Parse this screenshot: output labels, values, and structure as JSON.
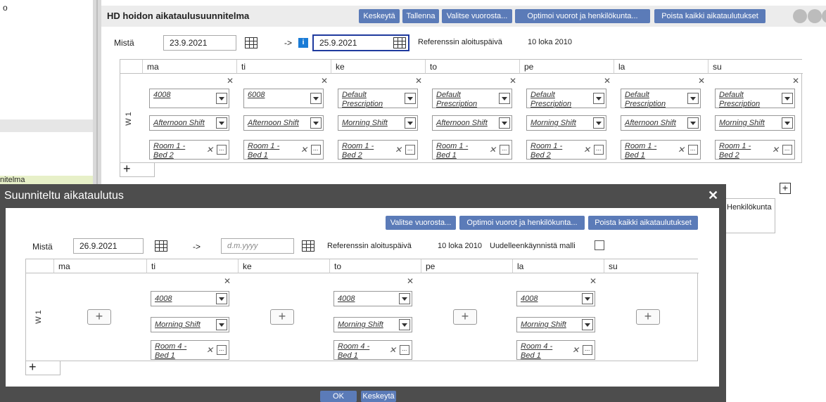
{
  "sidebar": {
    "top_text": "o",
    "green_label": "nitelma"
  },
  "main": {
    "title": "HD hoidon aikataulusuunnitelma",
    "buttons": [
      "Keskeytä",
      "Tallenna",
      "Valitse vuorosta...",
      "Optimoi vuorot ja henkilökunta...",
      "Poista kaikki aikataulutukset"
    ],
    "from_label": "Mistä",
    "from_date": "23.9.2021",
    "arrow": "->",
    "to_date": "25.9.2021",
    "ref_label": "Referenssin aloituspäivä",
    "ref_date": "10 loka 2010",
    "days": [
      "ma",
      "ti",
      "ke",
      "to",
      "pe",
      "la",
      "su"
    ],
    "week": "W 1",
    "cells": [
      {
        "presc": "4008",
        "shift": "Afternoon Shift",
        "room": "Room 1 - Bed 2"
      },
      {
        "presc": "6008",
        "shift": "Afternoon Shift",
        "room": "Room 1 - Bed 1"
      },
      {
        "presc": "Default Prescription",
        "shift": "Morning Shift",
        "room": "Room 1 - Bed 2"
      },
      {
        "presc": "Default Prescription",
        "shift": "Afternoon Shift",
        "room": "Room 1 - Bed 1"
      },
      {
        "presc": "Default Prescription",
        "shift": "Morning Shift",
        "room": "Room 1 - Bed 2"
      },
      {
        "presc": "Default Prescription",
        "shift": "Afternoon Shift",
        "room": "Room 1 - Bed 1"
      },
      {
        "presc": "Default Prescription",
        "shift": "Morning Shift",
        "room": "Room 1 - Bed 2"
      }
    ],
    "henkilokunta": "Henkilökunta"
  },
  "modal": {
    "title": "Suunniteltu aikataulutus",
    "close": "✕",
    "buttons": [
      "Valitse vuorosta...",
      "Optimoi vuorot ja henkilökunta...",
      "Poista kaikki aikataulutukset"
    ],
    "from_label": "Mistä",
    "from_date": "26.9.2021",
    "arrow": "->",
    "to_placeholder": "d.m.yyyy",
    "ref_label": "Referenssin aloituspäivä",
    "ref_date": "10 loka 2010",
    "restart_label": "Uudelleenkäynnistä malli",
    "days": [
      "ma",
      "ti",
      "ke",
      "to",
      "pe",
      "la",
      "su"
    ],
    "week": "W 1",
    "filled": {
      "presc": "4008",
      "shift": "Morning Shift",
      "room": "Room 4 - Bed 1"
    },
    "ok": "OK",
    "cancel": "Keskeytä"
  }
}
